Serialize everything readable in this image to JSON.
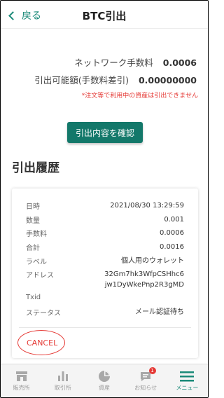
{
  "header": {
    "back_label": "戻る",
    "title": "BTC引出"
  },
  "fees": {
    "network_fee_label": "ネットワーク手数料",
    "network_fee_value": "0.0006",
    "available_label": "引出可能額(手数料差引)",
    "available_value": "0.00000000",
    "warning": "*注文等で利用中の資産は引出できません"
  },
  "confirm_button": "引出内容を確認",
  "history": {
    "title": "引出履歴",
    "rows": [
      {
        "label": "日時",
        "value": "2021/08/30 13:29:59"
      },
      {
        "label": "数量",
        "value": "0.001"
      },
      {
        "label": "手数料",
        "value": "0.0006"
      },
      {
        "label": "合計",
        "value": "0.0016"
      },
      {
        "label": "ラベル",
        "value": "個人用のウォレット"
      },
      {
        "label": "アドレス",
        "value": "32Gm7hk3WfpCSHhc6",
        "value2": "jw1DyWkePnp2R3gMD"
      },
      {
        "label": "Txid",
        "value": ""
      },
      {
        "label": "ステータス",
        "value": "メール認証待ち"
      }
    ],
    "cancel_label": "CANCEL"
  },
  "nav": {
    "items": [
      {
        "label": "販売所",
        "icon": "store-icon"
      },
      {
        "label": "取引所",
        "icon": "bar-chart-icon"
      },
      {
        "label": "資産",
        "icon": "pie-chart-icon"
      },
      {
        "label": "お知らせ",
        "icon": "notification-icon",
        "badge": "1"
      },
      {
        "label": "メニュー",
        "icon": "menu-icon"
      }
    ]
  },
  "colors": {
    "accent": "#1a8a78",
    "button": "#13786a",
    "warning": "#e53935"
  }
}
